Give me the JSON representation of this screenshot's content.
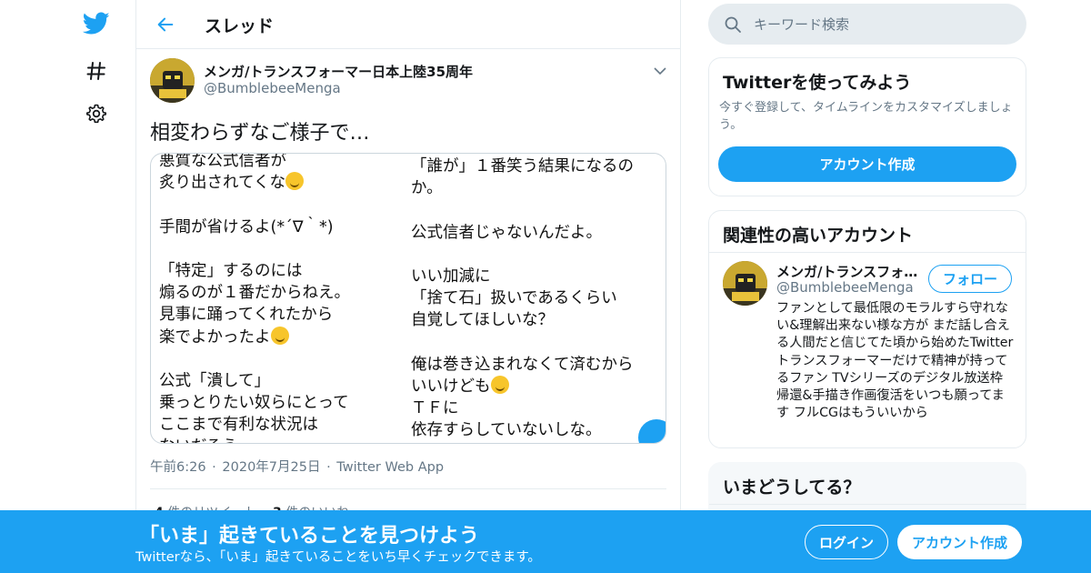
{
  "nav": {
    "logo_icon": "twitter-bird-icon",
    "explore_icon": "hashtag-icon",
    "settings_icon": "gear-icon",
    "brand_color": "#1da1f2"
  },
  "header": {
    "title": "スレッド",
    "back_icon": "arrow-left-icon"
  },
  "tweet": {
    "author_name": "メンガ/トランスフォーマー日本上陸35周年",
    "author_handle": "@BumblebeeMenga",
    "text": "相変わらずなご様子で…",
    "media_text": {
      "left_lines": [
        "悪質な公式信者が",
        "炙り出されてくな",
        "",
        "手間が省けるよ(*´∇｀*)",
        "",
        "「特定」するのには",
        "煽るのが１番だからねえ。",
        "見事に踊ってくれたから",
        "楽でよかったよ",
        "",
        "公式「潰して」",
        "乗っとりたい奴らにとって",
        "ここまで有利な状況は",
        "ないだろう"
      ],
      "right_lines": [
        "「誰が」１番笑う結果になるの",
        "か。",
        "",
        "公式信者じゃないんだよ。",
        "",
        "いい加減に",
        "「捨て石」扱いであるくらい",
        "自覚してほしいな？",
        "",
        "俺は巻き込まれなくて済むから",
        "いいけども",
        "ＴＦに",
        "依存すらしていないしな。"
      ]
    },
    "time": "午前6:26",
    "date": "2020年7月25日",
    "source": "Twitter Web App",
    "sep": "·",
    "retweets_count": "4",
    "retweets_label": "件のリツイート",
    "likes_count": "3",
    "likes_label": "件のいいね"
  },
  "search": {
    "placeholder": "キーワード検索",
    "icon": "search-icon"
  },
  "signup_card": {
    "title": "Twitterを使ってみよう",
    "description": "今すぐ登録して、タイムラインをカスタマイズしましょう。",
    "button_label": "アカウント作成"
  },
  "related": {
    "title": "関連性の高いアカウント",
    "account": {
      "name": "メンガ/トランスフォーマー日本上陸35周年",
      "handle": "@BumblebeeMenga",
      "follow_label": "フォロー",
      "bio": "ファンとして最低限のモラルすら守れない&理解出来ない様な方が まだ話し合える人間だと信じてた頃から始めたTwitter トランスフォーマーだけで精神が持ってるファン TVシリーズのデジタル放送枠帰還&手描き作画復活をいつも願ってます フルCGはもういいから"
    }
  },
  "trends": {
    "title": "いまどうしてる？"
  },
  "banner": {
    "title": "「いま」起きていることを見つけよう",
    "subtitle": "Twitterなら、「いま」起きていることをいち早くチェックできます。",
    "login_label": "ログイン",
    "signup_label": "アカウント作成"
  }
}
